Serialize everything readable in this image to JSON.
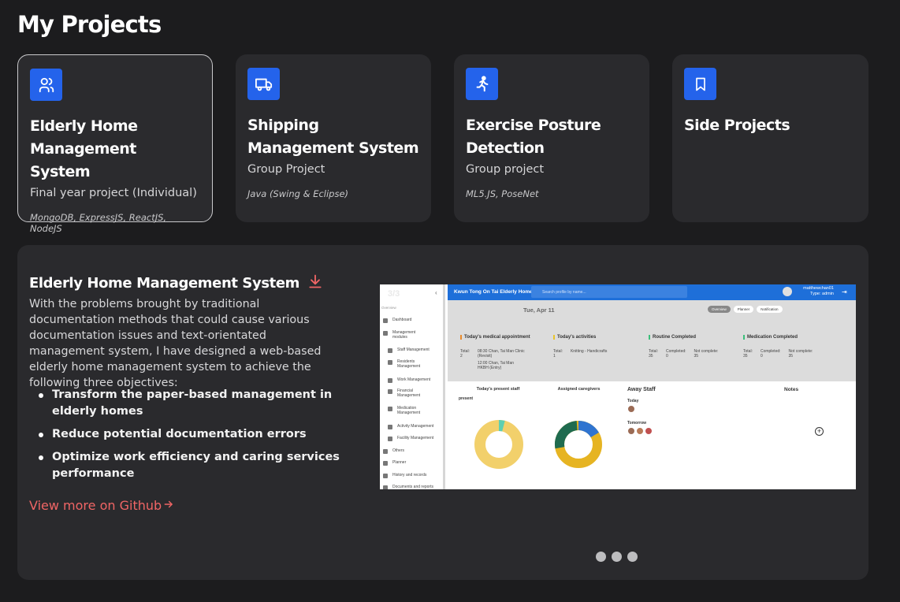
{
  "page": {
    "title": "My Projects"
  },
  "projects": [
    {
      "icon": "users-icon",
      "title": "Elderly Home Management System",
      "subtitle": "Final year project (Individual)",
      "tech": "MongoDB, ExpressJS, ReactJS, NodeJS"
    },
    {
      "icon": "truck-icon",
      "title": "Shipping Management System",
      "subtitle": "Group Project",
      "tech": "Java (Swing & Eclipse)"
    },
    {
      "icon": "running-person-icon",
      "title": "Exercise Posture Detection",
      "subtitle": "Group project",
      "tech": "ML5.JS, PoseNet"
    },
    {
      "icon": "bookmark-icon",
      "title": "Side Projects",
      "subtitle": "",
      "tech": ""
    }
  ],
  "detail": {
    "title": "Elderly Home Management System",
    "description": "With the problems brought by traditional documentation methods that could cause various documentation issues and text-orientated management system, I have designed a web-based elderly home management system to achieve the following three objectives:",
    "objectives": [
      "Transform the paper-based management in elderly homes",
      "Reduce potential documentation errors",
      "Optimize work efficiency and caring services performance"
    ],
    "github_link": "View more on Github",
    "carousel_count": 3
  },
  "screenshot": {
    "brand": "Kwun Tong On Tai Elderly Home",
    "search_placeholder": "Search profile by name...",
    "user_name": "matthewchan01",
    "user_type": "Type: admin",
    "logo": "3/3",
    "overview_label": "Overview",
    "sidebar": [
      "Dashboard",
      "Management modules",
      "Staff Management",
      "Residents Management",
      "Work Management",
      "Financial Management",
      "Medication Management",
      "Activity Management",
      "Facility Management",
      "Others",
      "Planner",
      "History and records",
      "Documents and reports"
    ],
    "date": "Tue, Apr 11",
    "tabs": [
      "Overview",
      "Planner",
      "Notification"
    ],
    "stats": [
      {
        "title": "Today's medical appointment",
        "total_label": "Total:",
        "total": "2",
        "items": [
          "08:30 Chan, Tai Man Clinic (Revisit)",
          "12:00 Chan, Tai Man HKBH (Entry)"
        ]
      },
      {
        "title": "Today's activities",
        "total_label": "Total:",
        "total": "1",
        "items": [
          "Knitting - Handicrafts"
        ]
      },
      {
        "title": "Routine Completed",
        "total_label": "Total:",
        "total": "35",
        "completed_label": "Completed:",
        "completed": "0",
        "not_label": "Not complete:",
        "not_completed": "35"
      },
      {
        "title": "Medication Completed",
        "total_label": "Total:",
        "total": "35",
        "completed_label": "Completed:",
        "completed": "0",
        "not_label": "Not complete:",
        "not_completed": "35"
      }
    ],
    "present_staff_title": "Today's present staff",
    "present_label": "present",
    "caregivers_title": "Assigned caregivers",
    "away_staff_title": "Away Staff",
    "away_today": "Today",
    "away_tomorrow": "Tomorrow",
    "notes_title": "Notes",
    "colors": {
      "blue": "#1e6fd9",
      "donut_yellow": "#f2d06b",
      "donut_green": "#1f6b4f",
      "donut_blue": "#2f74d0",
      "donut_teal": "#5ecfb1"
    }
  },
  "colors": {
    "accent_blue": "#2463eb",
    "link_red": "#f06565",
    "card_bg": "#2a2a2d",
    "page_bg": "#1c1c1e"
  }
}
